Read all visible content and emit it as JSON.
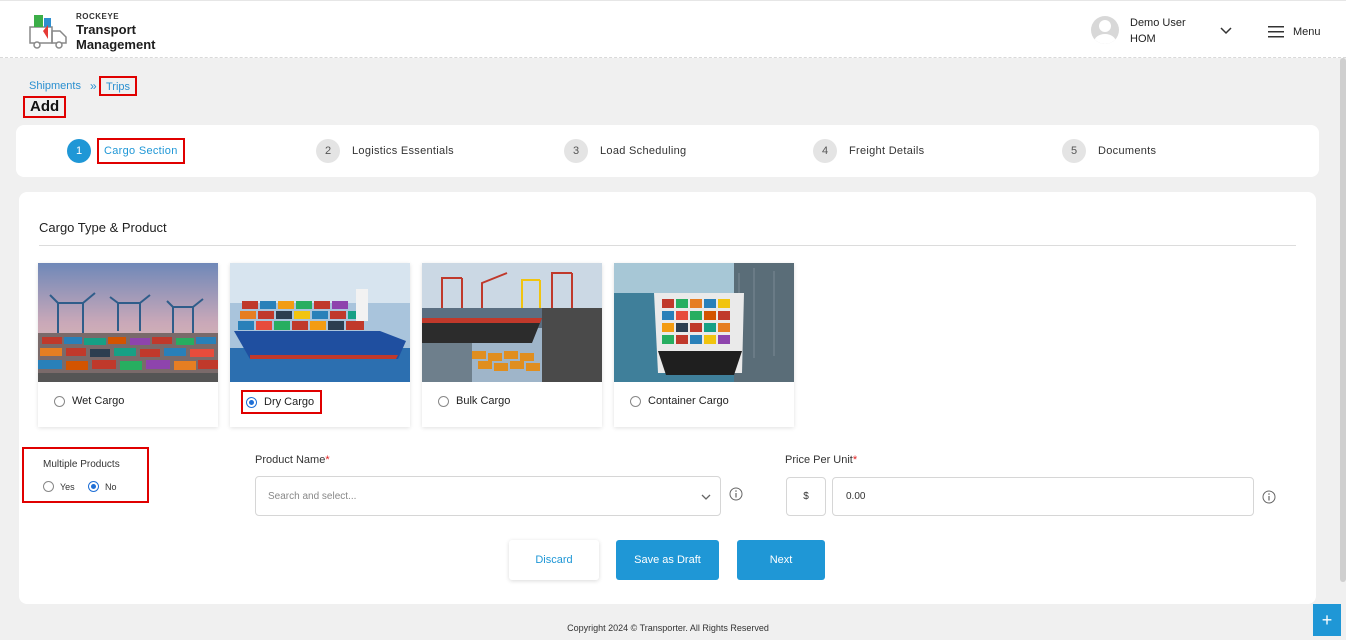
{
  "header": {
    "brand_small": "ROCKEYE",
    "brand_line1": "Transport",
    "brand_line2": "Management",
    "user_name": "Demo User",
    "user_role": "HOM",
    "menu_label": "Menu"
  },
  "breadcrumb": {
    "parent": "Shipments",
    "separator": "»",
    "current": "Trips"
  },
  "page_title": "Add",
  "steps": [
    {
      "num": "1",
      "label": "Cargo Section",
      "active": true
    },
    {
      "num": "2",
      "label": "Logistics Essentials"
    },
    {
      "num": "3",
      "label": "Load Scheduling"
    },
    {
      "num": "4",
      "label": "Freight Details"
    },
    {
      "num": "5",
      "label": "Documents"
    }
  ],
  "section": {
    "title": "Cargo Type & Product"
  },
  "cargo_types": [
    {
      "label": "Wet Cargo",
      "selected": false
    },
    {
      "label": "Dry Cargo",
      "selected": true
    },
    {
      "label": "Bulk Cargo",
      "selected": false
    },
    {
      "label": "Container Cargo",
      "selected": false
    }
  ],
  "multiple_products": {
    "label": "Multiple Products",
    "yes": "Yes",
    "no": "No",
    "selected": "No"
  },
  "product_name": {
    "label": "Product Name",
    "required_mark": "*",
    "placeholder": "Search and select..."
  },
  "price_per_unit": {
    "label": "Price Per Unit",
    "required_mark": "*",
    "currency": "$",
    "value": "0.00"
  },
  "buttons": {
    "discard": "Discard",
    "save_draft": "Save as Draft",
    "next": "Next"
  },
  "footer": "Copyright 2024 © Transporter. All Rights Reserved",
  "fab_label": "+",
  "colors": {
    "accent": "#1f97d6",
    "highlight": "#e00000"
  }
}
